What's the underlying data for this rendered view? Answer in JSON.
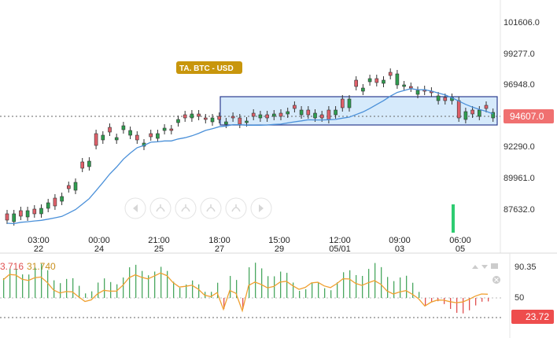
{
  "symbol_badge": "TA.  BTC - USD",
  "price_axis": [
    "101606.0",
    "99277.0",
    "96948.0",
    "94607.0",
    "92290.0",
    "89961.0",
    "87632.0"
  ],
  "current_price": "94607.0",
  "time_axis": [
    {
      "time": "03:00",
      "date": "22"
    },
    {
      "time": "00:00",
      "date": "24"
    },
    {
      "time": "21:00",
      "date": "25"
    },
    {
      "time": "18:00",
      "date": "27"
    },
    {
      "time": "15:00",
      "date": "29"
    },
    {
      "time": "12:00",
      "date": "05/01"
    },
    {
      "time": "09:00",
      "date": "03"
    },
    {
      "time": "06:00",
      "date": "05"
    }
  ],
  "indicator": {
    "value_a": "3.716",
    "value_b": "31.740",
    "axis_labels": [
      "90.35",
      "50"
    ],
    "current_value": "23.72"
  },
  "toolbar_icons": [
    "arrow-left-icon",
    "draw-tool-icon-1",
    "draw-tool-icon-2",
    "draw-tool-icon-3",
    "draw-tool-icon-4",
    "arrow-right-icon"
  ],
  "colors": {
    "up": "#2e9e4f",
    "down": "#e0606a",
    "ma_line": "#4a90d9",
    "zone_fill": "#cfe6fa",
    "zone_border": "#2c3e8f",
    "badge_bg": "#c8960c",
    "badge_text": "#ffffff",
    "price_tag": "#f07070",
    "osc_line": "#f0a030"
  }
}
